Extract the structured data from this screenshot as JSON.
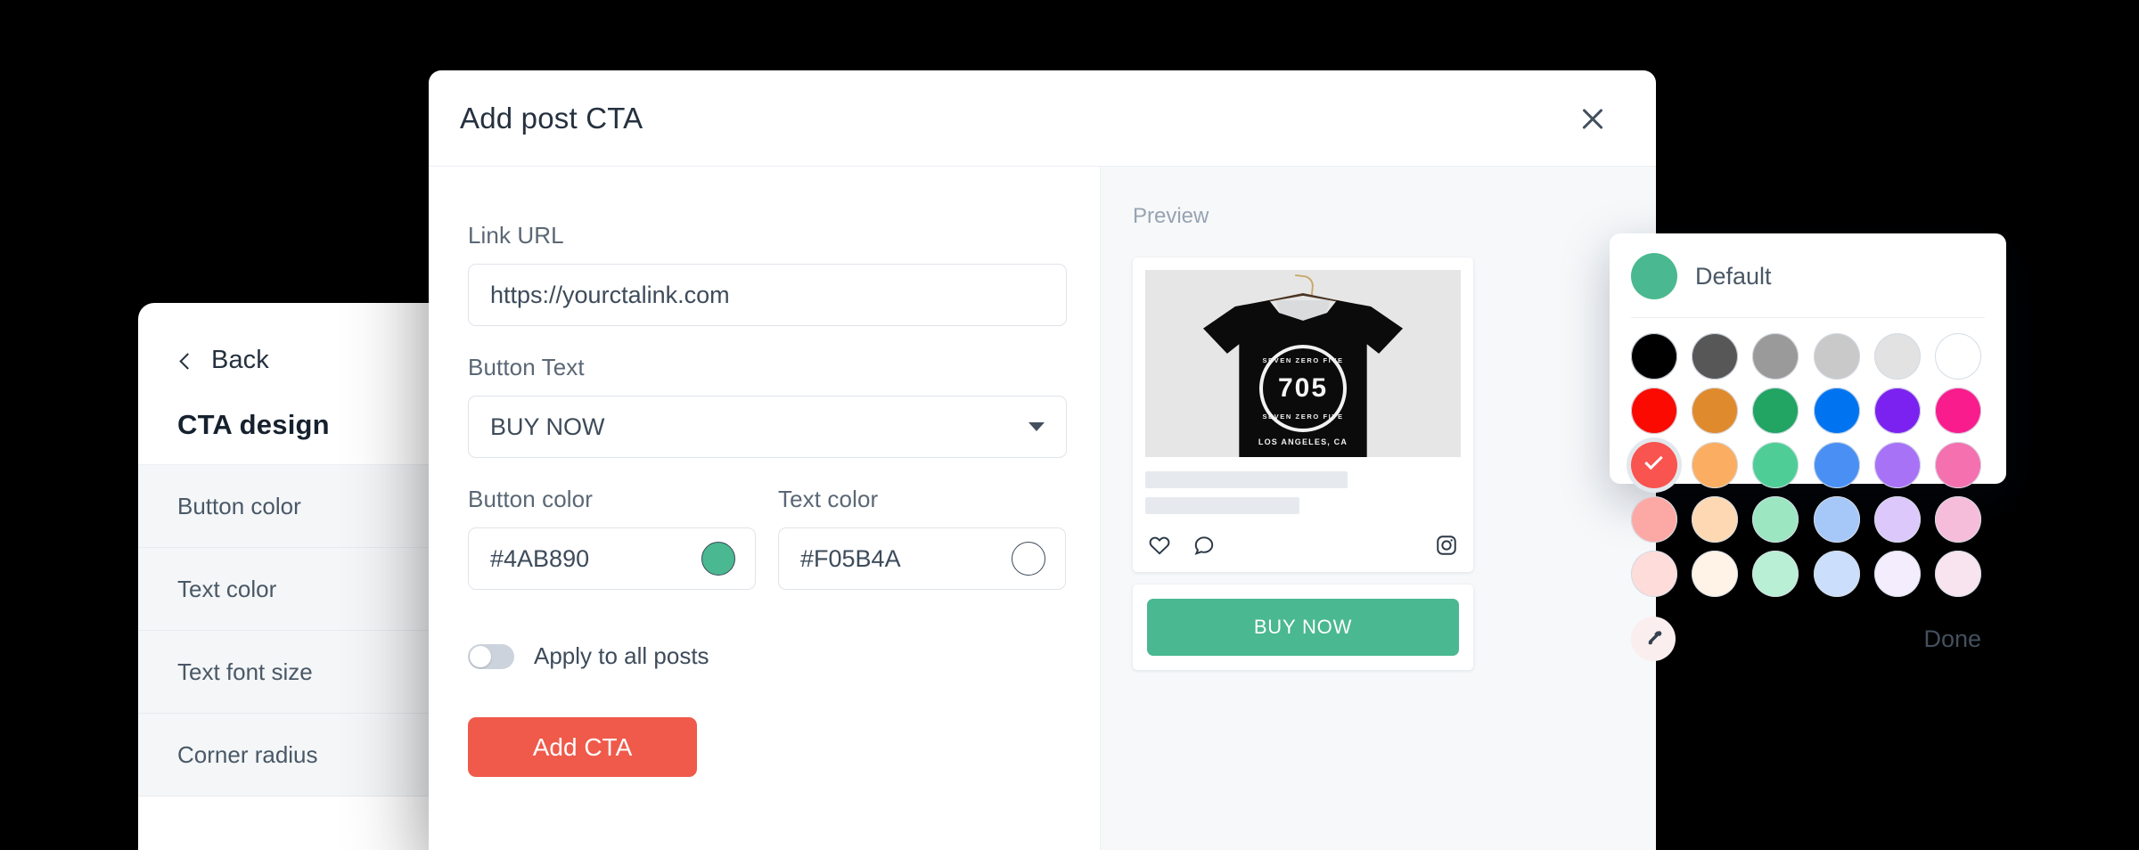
{
  "side_panel": {
    "back_label": "Back",
    "title": "CTA design",
    "items": [
      {
        "label": "Button color"
      },
      {
        "label": "Text color"
      },
      {
        "label": "Text font size"
      },
      {
        "label": "Corner radius"
      }
    ]
  },
  "modal": {
    "title": "Add post CTA",
    "close_icon": "close-icon",
    "form": {
      "link_url": {
        "label": "Link URL",
        "value": "https://yourctalink.com",
        "placeholder": "https://yourctalink.com"
      },
      "button_text": {
        "label": "Button Text",
        "value": "BUY NOW",
        "caret_icon": "chevron-down-icon"
      },
      "button_color": {
        "label": "Button color",
        "value": "#4AB890",
        "swatch": "#4AB890"
      },
      "text_color": {
        "label": "Text color",
        "value": "#F05B4A",
        "swatch": "#FFFFFF"
      },
      "apply_all": {
        "label": "Apply to all posts",
        "enabled": false
      },
      "submit_label": "Add CTA",
      "submit_color": "#EF5A4B"
    }
  },
  "preview": {
    "label": "Preview",
    "post": {
      "image_alt": "black-tshirt-on-hanger",
      "shirt_logo": {
        "arc_top": "SEVEN ZERO FIVE",
        "number": "705",
        "arc_bottom": "SEVEN ZERO FIVE",
        "city": "LOS ANGELES, CA"
      },
      "actions": {
        "like_icon": "heart-icon",
        "comment_icon": "comment-icon",
        "source_icon": "instagram-icon"
      }
    },
    "cta_button": {
      "label": "BUY NOW",
      "background": "#4AB890",
      "text_color": "#FFFFFF"
    }
  },
  "color_picker": {
    "header": {
      "label": "Default",
      "swatch": "#4AB890"
    },
    "eyedropper_icon": "eyedropper-icon",
    "done_label": "Done",
    "selected_index": 12,
    "swatches": [
      "#000000",
      "#575757",
      "#9A9A9A",
      "#C9C9C9",
      "#E2E2E2",
      "#FFFFFF",
      "#FA0A00",
      "#E08A2E",
      "#22A462",
      "#0074F0",
      "#7C22F0",
      "#F91C8C",
      "#F9544F",
      "#FBAE62",
      "#4ECE96",
      "#4A90F4",
      "#A872F6",
      "#F470AF",
      "#FCA9A6",
      "#FDD8B2",
      "#9CE6C2",
      "#A6C8F8",
      "#DCC8FB",
      "#F5BDD9",
      "#FDDCDA",
      "#FEF3E6",
      "#B9EFD4",
      "#CBDEFB",
      "#F4EDFD",
      "#F7E4EE"
    ]
  }
}
